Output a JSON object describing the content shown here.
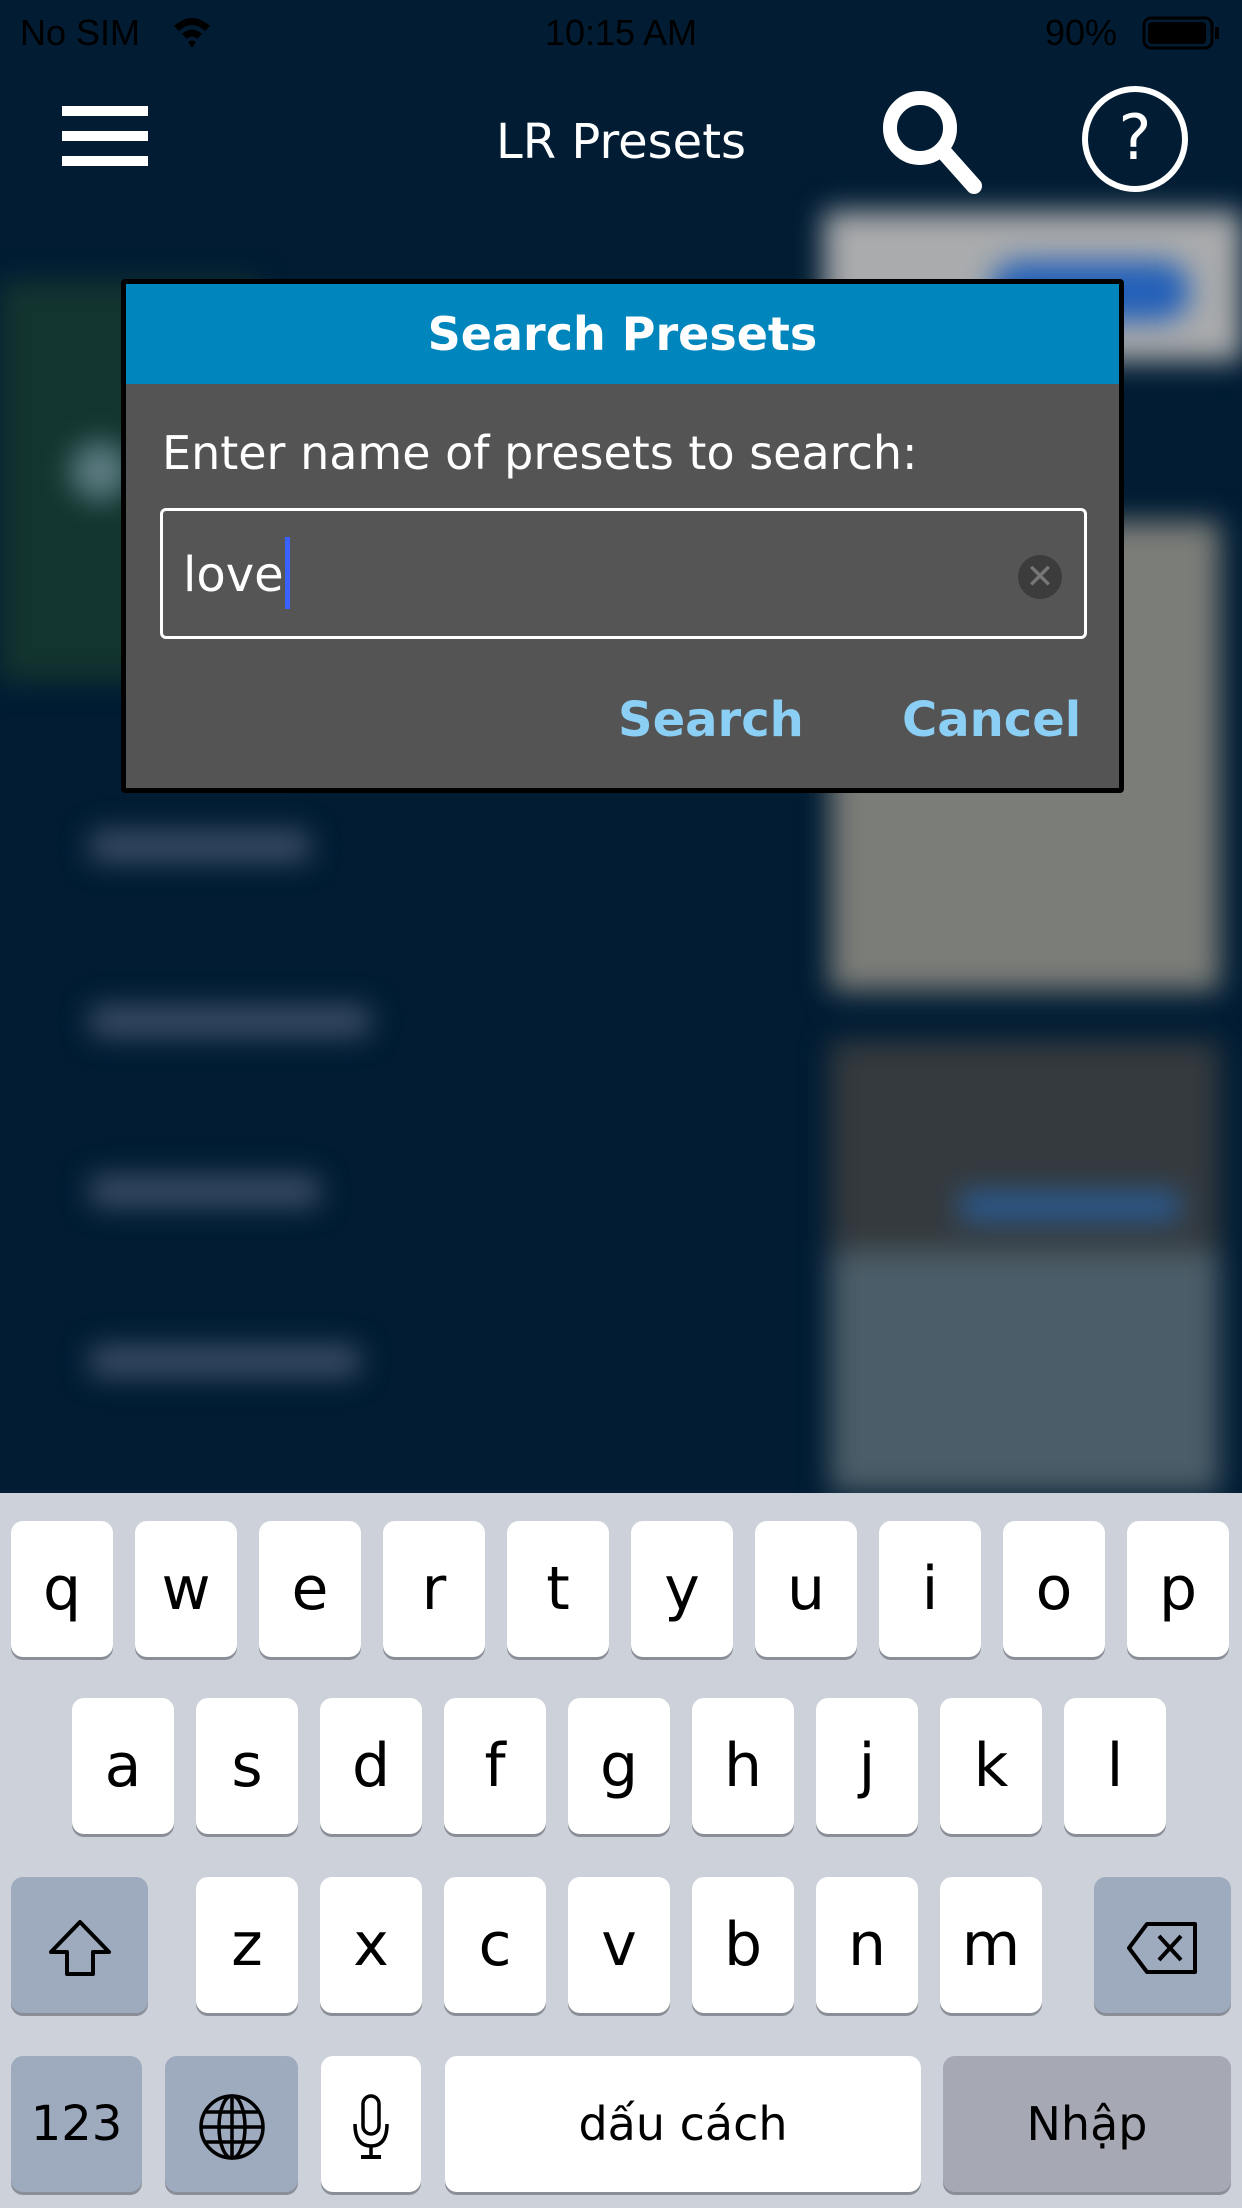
{
  "status": {
    "carrier": "No SIM",
    "time": "10:15 AM",
    "battery": "90%"
  },
  "nav": {
    "title": "LR Presets",
    "menu_icon": "hamburger-icon",
    "search_icon": "search-icon",
    "help_icon": "help-icon"
  },
  "dialog": {
    "title": "Search Presets",
    "label": "Enter name of presets to search:",
    "input_value": "love",
    "search_label": "Search",
    "cancel_label": "Cancel"
  },
  "colors": {
    "nav_bg": "#011c33",
    "dialog_header": "#0185bd",
    "dialog_bg": "#545454",
    "button_text": "#8ccff5"
  },
  "keyboard": {
    "row1": [
      "q",
      "w",
      "e",
      "r",
      "t",
      "y",
      "u",
      "i",
      "o",
      "p"
    ],
    "row2": [
      "a",
      "s",
      "d",
      "f",
      "g",
      "h",
      "j",
      "k",
      "l"
    ],
    "row3": [
      "z",
      "x",
      "c",
      "v",
      "b",
      "n",
      "m"
    ],
    "numbers": "123",
    "space": "dấu cách",
    "return": "Nhập"
  }
}
